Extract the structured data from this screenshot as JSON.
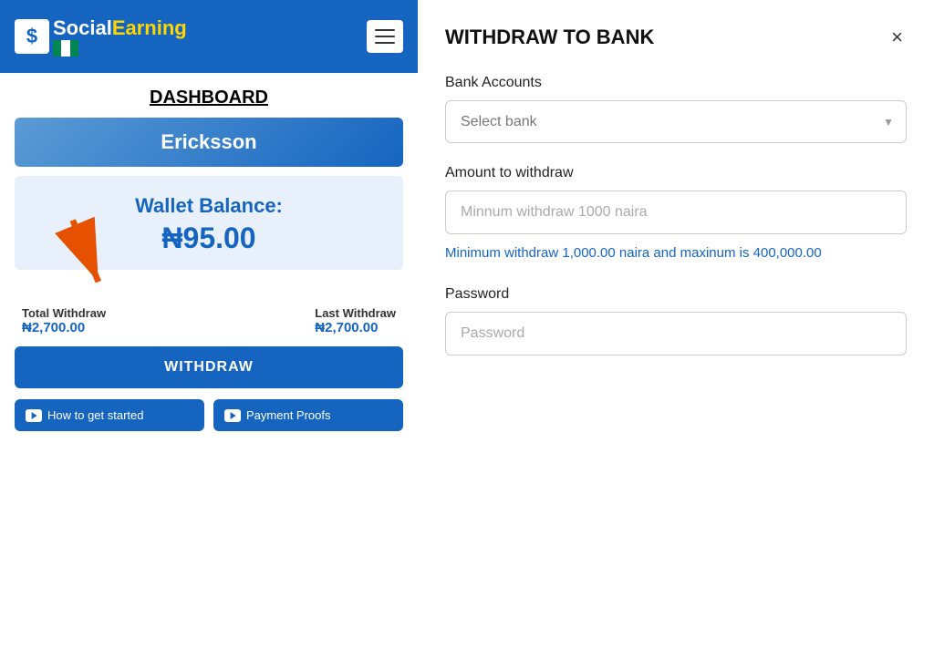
{
  "app": {
    "logo_social": "Social",
    "logo_earning": "Earning"
  },
  "left": {
    "dashboard_title": "DASHBOARD",
    "user_name": "Ericksson",
    "wallet_label": "Wallet Balance:",
    "wallet_amount": "₦95.00",
    "total_withdraw_label": "Total Withdraw",
    "total_withdraw_value": "₦2,700.00",
    "last_withdraw_label": "Last Withdraw",
    "last_withdraw_value": "₦2,700.00",
    "withdraw_btn_label": "WITHDRAW",
    "how_to_start_label": "How to get started",
    "payment_proofs_label": "Payment Proofs"
  },
  "modal": {
    "title": "WITHDRAW TO BANK",
    "close_label": "×",
    "bank_accounts_label": "Bank Accounts",
    "select_bank_placeholder": "Select bank",
    "amount_label": "Amount to withdraw",
    "amount_placeholder": "Minnum withdraw 1000 naira",
    "amount_hint": "Minimum withdraw 1,000.00 naira and maxinum is 400,000.00",
    "password_label": "Password",
    "password_placeholder": "Password"
  }
}
